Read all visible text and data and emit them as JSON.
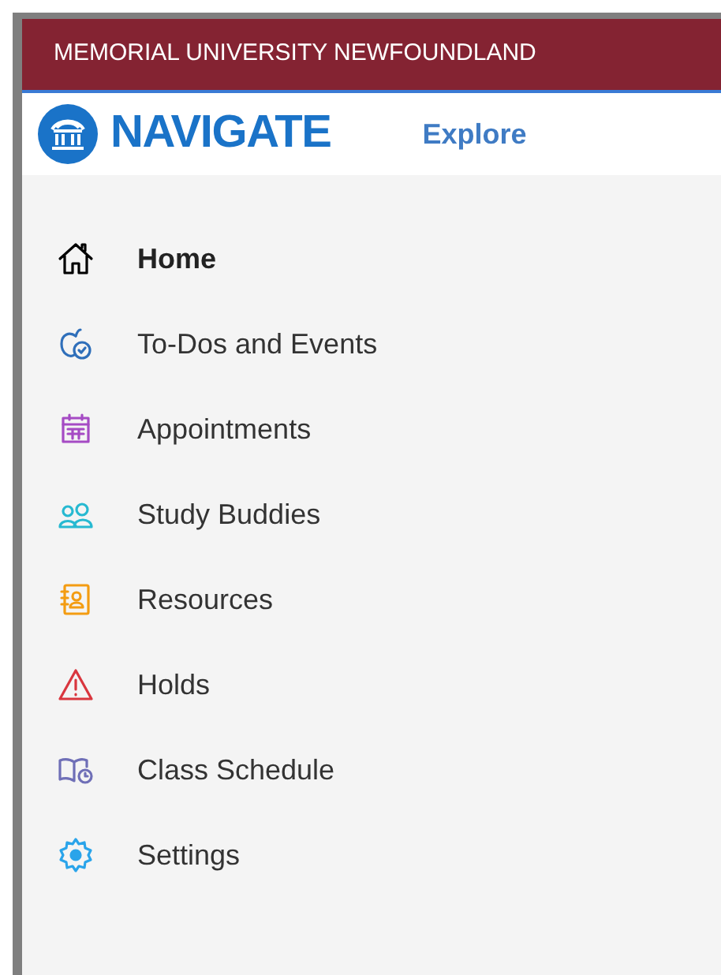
{
  "banner": {
    "title": "MEMORIAL UNIVERSITY NEWFOUNDLAND"
  },
  "header": {
    "logo": "NAVIGATE",
    "nav_link": "Explore"
  },
  "menu": [
    {
      "label": "Home",
      "kind": "home",
      "selected": true
    },
    {
      "label": "To-Dos and Events",
      "kind": "todos",
      "selected": false
    },
    {
      "label": "Appointments",
      "kind": "calendar",
      "selected": false
    },
    {
      "label": "Study Buddies",
      "kind": "people",
      "selected": false
    },
    {
      "label": "Resources",
      "kind": "book",
      "selected": false
    },
    {
      "label": "Holds",
      "kind": "warning",
      "selected": false
    },
    {
      "label": "Class Schedule",
      "kind": "schedule",
      "selected": false
    },
    {
      "label": "Settings",
      "kind": "gear",
      "selected": false
    }
  ]
}
